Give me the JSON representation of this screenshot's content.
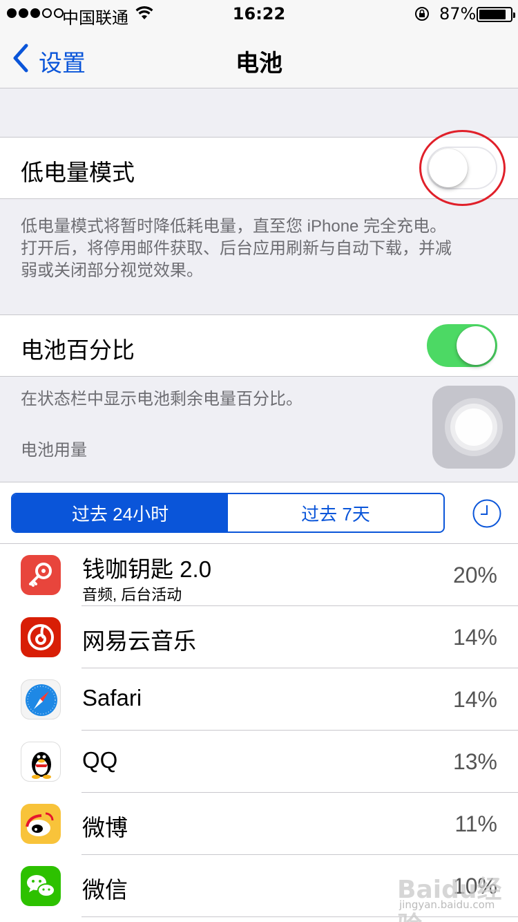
{
  "status_bar": {
    "carrier": "中国联通",
    "time": "16:22",
    "battery_percent": "87%",
    "battery_level": 0.87,
    "signal_bars_filled": 3,
    "signal_bars_total": 5
  },
  "nav": {
    "back_label": "设置",
    "title": "电池"
  },
  "low_power": {
    "label": "低电量模式",
    "enabled": false,
    "footnote_line1": "低电量模式将暂时降低耗电量，直至您 iPhone 完全充电。",
    "footnote_line2": "打开后，将停用邮件获取、后台应用刷新与自动下载，并减",
    "footnote_line3": "弱或关闭部分视觉效果。"
  },
  "battery_percentage": {
    "label": "电池百分比",
    "enabled": true,
    "footnote": "在状态栏中显示电池剩余电量百分比。"
  },
  "usage": {
    "section_header": "电池用量",
    "segments": [
      "过去 24小时",
      "过去 7天"
    ],
    "selected_segment": 0,
    "apps": [
      {
        "name": "钱咖钥匙 2.0",
        "detail": "音频, 后台活动",
        "percent": "20%",
        "icon": "key-app-icon",
        "color": "#e8453c"
      },
      {
        "name": "网易云音乐",
        "detail": "",
        "percent": "14%",
        "icon": "netease-music-icon",
        "color": "#d81e06"
      },
      {
        "name": "Safari",
        "detail": "",
        "percent": "14%",
        "icon": "safari-icon",
        "color": "#1e88e5"
      },
      {
        "name": "QQ",
        "detail": "",
        "percent": "13%",
        "icon": "qq-icon",
        "color": "#000000"
      },
      {
        "name": "微博",
        "detail": "",
        "percent": "11%",
        "icon": "weibo-icon",
        "color": "#f8c33a"
      },
      {
        "name": "微信",
        "detail": "",
        "percent": "10%",
        "icon": "wechat-icon",
        "color": "#2dc100"
      }
    ]
  },
  "watermark": {
    "text": "Baidu经验",
    "sub": "jingyan.baidu.com"
  },
  "colors": {
    "ios_blue": "#0a55d9",
    "toggle_green": "#4cd964",
    "annotation_red": "#e0202a"
  }
}
